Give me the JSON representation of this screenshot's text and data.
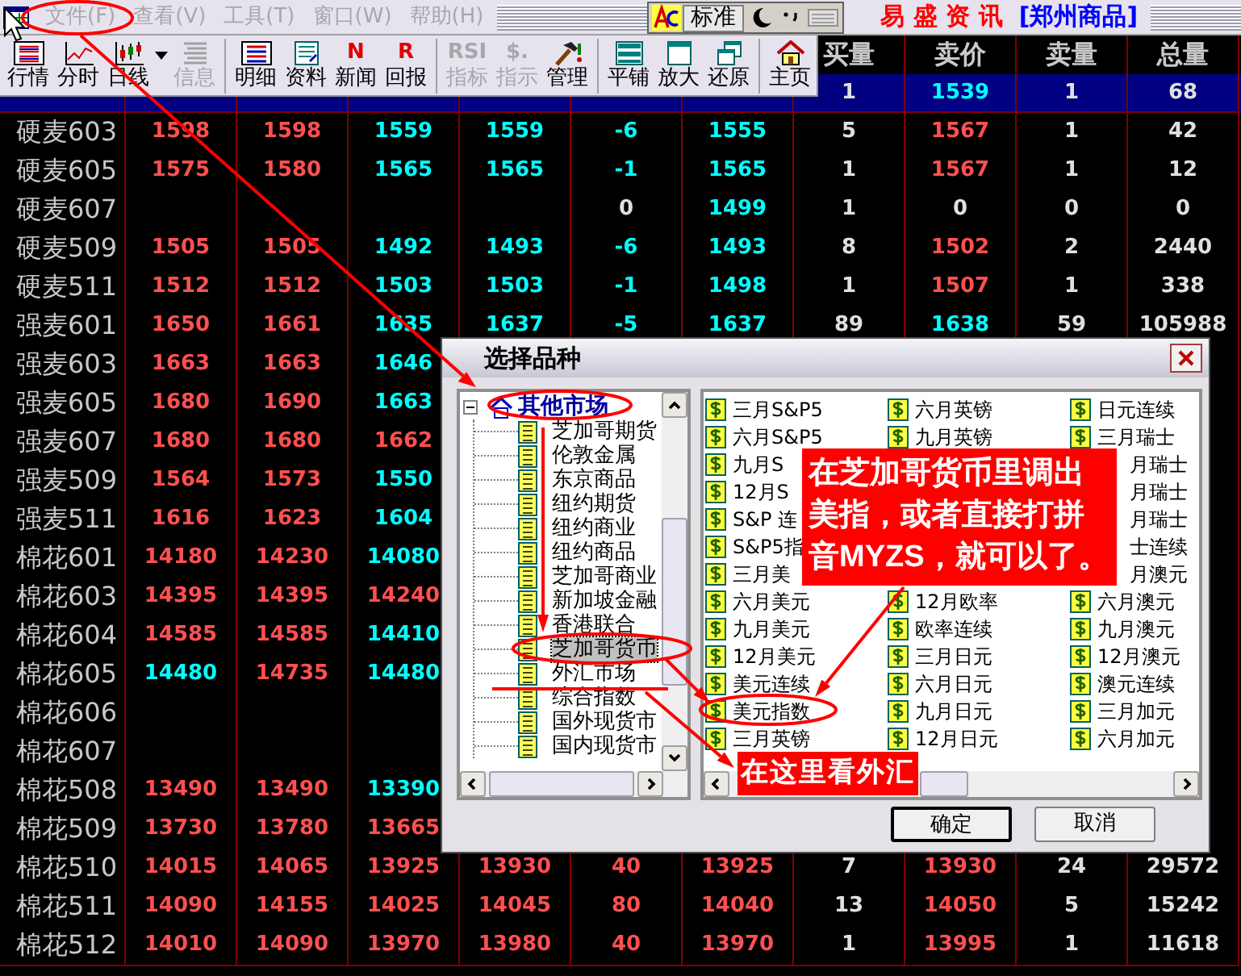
{
  "menu_bar": {
    "items": [
      {
        "label": "文件(F)",
        "disabled": true
      },
      {
        "label": "查看(V)",
        "disabled": true
      },
      {
        "label": "工具(T)",
        "disabled": true
      },
      {
        "label": "窗口(W)",
        "disabled": true
      },
      {
        "label": "帮助(H)",
        "disabled": true
      }
    ]
  },
  "ime_bar": {
    "mode": "标准"
  },
  "title": {
    "name": "易 盛 资 讯",
    "market": "[郑州商品]"
  },
  "toolbar": [
    [
      {
        "label": "行情",
        "kind": "quote",
        "disabled": false,
        "dropdown": false
      },
      {
        "label": "分时",
        "kind": "chart",
        "disabled": false,
        "dropdown": false
      },
      {
        "label": "日线",
        "kind": "candle",
        "disabled": false,
        "dropdown": true
      },
      {
        "label": "信息",
        "kind": "info",
        "disabled": true,
        "dropdown": false
      }
    ],
    [
      {
        "label": "明细",
        "kind": "detail",
        "disabled": false,
        "dropdown": false
      },
      {
        "label": "资料",
        "kind": "doc",
        "disabled": false,
        "dropdown": false
      },
      {
        "label": "新闻",
        "kind": "letter",
        "icon_text": "N",
        "disabled": false,
        "dropdown": false
      },
      {
        "label": "回报",
        "kind": "letter",
        "icon_text": "R",
        "disabled": false,
        "dropdown": false
      }
    ],
    [
      {
        "label": "指标",
        "kind": "letter",
        "icon_text": "RSI",
        "disabled": true,
        "dropdown": false
      },
      {
        "label": "指示",
        "kind": "letter",
        "icon_text": "$.",
        "disabled": true,
        "dropdown": false
      },
      {
        "label": "管理",
        "kind": "hammer",
        "disabled": false,
        "dropdown": false
      }
    ],
    [
      {
        "label": "平铺",
        "kind": "tile",
        "disabled": false,
        "dropdown": false
      },
      {
        "label": "放大",
        "kind": "window",
        "disabled": false,
        "dropdown": false
      },
      {
        "label": "还原",
        "kind": "restore",
        "disabled": false,
        "dropdown": false
      }
    ],
    [
      {
        "label": "主页",
        "kind": "home",
        "disabled": false,
        "dropdown": false
      }
    ]
  ],
  "quote_table": {
    "columns": [
      "",
      "",
      "",
      "",
      "",
      "",
      "买量",
      "卖价",
      "卖量",
      "总量"
    ],
    "rows": [
      {
        "name": null,
        "selected": true,
        "cells": [
          null,
          null,
          null,
          null,
          null,
          null,
          {
            "text": "1",
            "color": "#e0e0e0"
          },
          {
            "text": "1539",
            "color": "#00ffff"
          },
          {
            "text": "1",
            "color": "#e0e0e0"
          },
          {
            "text": "68",
            "color": "#e0e0e0"
          }
        ]
      },
      {
        "name": "硬麦603",
        "selected": false,
        "cells": [
          {
            "text": "1598",
            "color": "#ff5050"
          },
          {
            "text": "1598",
            "color": "#ff5050"
          },
          {
            "text": "1559",
            "color": "#00ffff"
          },
          {
            "text": "1559",
            "color": "#00ffff"
          },
          {
            "text": "-6",
            "color": "#00ffff"
          },
          {
            "text": "1555",
            "color": "#00ffff"
          },
          {
            "text": "5",
            "color": "#e0e0e0"
          },
          {
            "text": "1567",
            "color": "#ff5050"
          },
          {
            "text": "1",
            "color": "#e0e0e0"
          },
          {
            "text": "42",
            "color": "#e0e0e0"
          }
        ]
      },
      {
        "name": "硬麦605",
        "selected": false,
        "cells": [
          {
            "text": "1575",
            "color": "#ff5050"
          },
          {
            "text": "1580",
            "color": "#ff5050"
          },
          {
            "text": "1565",
            "color": "#00ffff"
          },
          {
            "text": "1565",
            "color": "#00ffff"
          },
          {
            "text": "-1",
            "color": "#00ffff"
          },
          {
            "text": "1565",
            "color": "#00ffff"
          },
          {
            "text": "1",
            "color": "#e0e0e0"
          },
          {
            "text": "1567",
            "color": "#ff5050"
          },
          {
            "text": "1",
            "color": "#e0e0e0"
          },
          {
            "text": "12",
            "color": "#e0e0e0"
          }
        ]
      },
      {
        "name": "硬麦607",
        "selected": false,
        "cells": [
          null,
          null,
          null,
          null,
          {
            "text": "0",
            "color": "#e0e0e0"
          },
          {
            "text": "1499",
            "color": "#00ffff"
          },
          {
            "text": "1",
            "color": "#e0e0e0"
          },
          {
            "text": "0",
            "color": "#e0e0e0"
          },
          {
            "text": "0",
            "color": "#e0e0e0"
          },
          {
            "text": "0",
            "color": "#e0e0e0"
          }
        ]
      },
      {
        "name": "硬麦509",
        "selected": false,
        "cells": [
          {
            "text": "1505",
            "color": "#ff5050"
          },
          {
            "text": "1505",
            "color": "#ff5050"
          },
          {
            "text": "1492",
            "color": "#00ffff"
          },
          {
            "text": "1493",
            "color": "#00ffff"
          },
          {
            "text": "-6",
            "color": "#00ffff"
          },
          {
            "text": "1493",
            "color": "#00ffff"
          },
          {
            "text": "8",
            "color": "#e0e0e0"
          },
          {
            "text": "1502",
            "color": "#ff5050"
          },
          {
            "text": "2",
            "color": "#e0e0e0"
          },
          {
            "text": "2440",
            "color": "#e0e0e0"
          }
        ]
      },
      {
        "name": "硬麦511",
        "selected": false,
        "cells": [
          {
            "text": "1512",
            "color": "#ff5050"
          },
          {
            "text": "1512",
            "color": "#ff5050"
          },
          {
            "text": "1503",
            "color": "#00ffff"
          },
          {
            "text": "1503",
            "color": "#00ffff"
          },
          {
            "text": "-1",
            "color": "#00ffff"
          },
          {
            "text": "1498",
            "color": "#00ffff"
          },
          {
            "text": "1",
            "color": "#e0e0e0"
          },
          {
            "text": "1507",
            "color": "#ff5050"
          },
          {
            "text": "1",
            "color": "#e0e0e0"
          },
          {
            "text": "338",
            "color": "#e0e0e0"
          }
        ]
      },
      {
        "name": "强麦601",
        "selected": false,
        "cells": [
          {
            "text": "1650",
            "color": "#ff5050"
          },
          {
            "text": "1661",
            "color": "#ff5050"
          },
          {
            "text": "1635",
            "color": "#00ffff"
          },
          {
            "text": "1637",
            "color": "#00ffff"
          },
          {
            "text": "-5",
            "color": "#00ffff"
          },
          {
            "text": "1637",
            "color": "#00ffff"
          },
          {
            "text": "89",
            "color": "#e0e0e0"
          },
          {
            "text": "1638",
            "color": "#00ffff"
          },
          {
            "text": "59",
            "color": "#e0e0e0"
          },
          {
            "text": "105988",
            "color": "#e0e0e0"
          }
        ]
      },
      {
        "name": "强麦603",
        "selected": false,
        "cells": [
          {
            "text": "1663",
            "color": "#ff5050"
          },
          {
            "text": "1663",
            "color": "#ff5050"
          },
          {
            "text": "1646",
            "color": "#00ffff"
          },
          null,
          null,
          null,
          null,
          null,
          null,
          null
        ]
      },
      {
        "name": "强麦605",
        "selected": false,
        "cells": [
          {
            "text": "1680",
            "color": "#ff5050"
          },
          {
            "text": "1690",
            "color": "#ff5050"
          },
          {
            "text": "1663",
            "color": "#00ffff"
          },
          null,
          null,
          null,
          null,
          null,
          null,
          null
        ]
      },
      {
        "name": "强麦607",
        "selected": false,
        "cells": [
          {
            "text": "1680",
            "color": "#ff5050"
          },
          {
            "text": "1680",
            "color": "#ff5050"
          },
          {
            "text": "1662",
            "color": "#ff5050"
          },
          null,
          null,
          null,
          null,
          null,
          null,
          null
        ]
      },
      {
        "name": "强麦509",
        "selected": false,
        "cells": [
          {
            "text": "1564",
            "color": "#ff5050"
          },
          {
            "text": "1573",
            "color": "#ff5050"
          },
          {
            "text": "1550",
            "color": "#00ffff"
          },
          null,
          null,
          null,
          null,
          null,
          null,
          null
        ]
      },
      {
        "name": "强麦511",
        "selected": false,
        "cells": [
          {
            "text": "1616",
            "color": "#ff5050"
          },
          {
            "text": "1623",
            "color": "#ff5050"
          },
          {
            "text": "1604",
            "color": "#00ffff"
          },
          null,
          null,
          null,
          null,
          null,
          null,
          null
        ]
      },
      {
        "name": "棉花601",
        "selected": false,
        "cells": [
          {
            "text": "14180",
            "color": "#ff5050"
          },
          {
            "text": "14230",
            "color": "#ff5050"
          },
          {
            "text": "14080",
            "color": "#00ffff"
          },
          null,
          null,
          null,
          null,
          null,
          null,
          null
        ]
      },
      {
        "name": "棉花603",
        "selected": false,
        "cells": [
          {
            "text": "14395",
            "color": "#ff5050"
          },
          {
            "text": "14395",
            "color": "#ff5050"
          },
          {
            "text": "14240",
            "color": "#ff5050"
          },
          null,
          null,
          null,
          null,
          null,
          null,
          null
        ]
      },
      {
        "name": "棉花604",
        "selected": false,
        "cells": [
          {
            "text": "14585",
            "color": "#ff5050"
          },
          {
            "text": "14585",
            "color": "#ff5050"
          },
          {
            "text": "14410",
            "color": "#00ffff"
          },
          null,
          null,
          null,
          null,
          null,
          null,
          null
        ]
      },
      {
        "name": "棉花605",
        "selected": false,
        "cells": [
          {
            "text": "14480",
            "color": "#00ffff"
          },
          {
            "text": "14735",
            "color": "#ff5050"
          },
          {
            "text": "14480",
            "color": "#00ffff"
          },
          null,
          null,
          null,
          null,
          null,
          null,
          null
        ]
      },
      {
        "name": "棉花606",
        "selected": false,
        "cells": [
          null,
          null,
          null,
          null,
          null,
          null,
          null,
          null,
          null,
          null
        ]
      },
      {
        "name": "棉花607",
        "selected": false,
        "cells": [
          null,
          null,
          null,
          null,
          null,
          null,
          null,
          null,
          null,
          null
        ]
      },
      {
        "name": "棉花508",
        "selected": false,
        "cells": [
          {
            "text": "13490",
            "color": "#ff5050"
          },
          {
            "text": "13490",
            "color": "#ff5050"
          },
          {
            "text": "13390",
            "color": "#00ffff"
          },
          null,
          null,
          null,
          null,
          null,
          null,
          null
        ]
      },
      {
        "name": "棉花509",
        "selected": false,
        "cells": [
          {
            "text": "13730",
            "color": "#ff5050"
          },
          {
            "text": "13780",
            "color": "#ff5050"
          },
          {
            "text": "13665",
            "color": "#ff5050"
          },
          null,
          null,
          null,
          null,
          null,
          null,
          null
        ]
      },
      {
        "name": "棉花510",
        "selected": false,
        "cells": [
          {
            "text": "14015",
            "color": "#ff5050"
          },
          {
            "text": "14065",
            "color": "#ff5050"
          },
          {
            "text": "13925",
            "color": "#ff5050"
          },
          {
            "text": "13930",
            "color": "#ff5050"
          },
          {
            "text": "40",
            "color": "#ff5050"
          },
          {
            "text": "13925",
            "color": "#ff5050"
          },
          {
            "text": "7",
            "color": "#e0e0e0"
          },
          {
            "text": "13930",
            "color": "#ff5050"
          },
          {
            "text": "24",
            "color": "#e0e0e0"
          },
          {
            "text": "29572",
            "color": "#e0e0e0"
          }
        ]
      },
      {
        "name": "棉花511",
        "selected": false,
        "cells": [
          {
            "text": "14090",
            "color": "#ff5050"
          },
          {
            "text": "14155",
            "color": "#ff5050"
          },
          {
            "text": "14025",
            "color": "#ff5050"
          },
          {
            "text": "14045",
            "color": "#ff5050"
          },
          {
            "text": "80",
            "color": "#ff5050"
          },
          {
            "text": "14040",
            "color": "#ff5050"
          },
          {
            "text": "13",
            "color": "#e0e0e0"
          },
          {
            "text": "14050",
            "color": "#ff5050"
          },
          {
            "text": "5",
            "color": "#e0e0e0"
          },
          {
            "text": "15242",
            "color": "#e0e0e0"
          }
        ]
      },
      {
        "name": "棉花512",
        "selected": false,
        "cells": [
          {
            "text": "14010",
            "color": "#ff5050"
          },
          {
            "text": "14090",
            "color": "#ff5050"
          },
          {
            "text": "13970",
            "color": "#ff5050"
          },
          {
            "text": "13980",
            "color": "#ff5050"
          },
          {
            "text": "40",
            "color": "#ff5050"
          },
          {
            "text": "13970",
            "color": "#ff5050"
          },
          {
            "text": "1",
            "color": "#e0e0e0"
          },
          {
            "text": "13995",
            "color": "#ff5050"
          },
          {
            "text": "1",
            "color": "#e0e0e0"
          },
          {
            "text": "11618",
            "color": "#e0e0e0"
          }
        ]
      }
    ]
  },
  "dialog": {
    "title": "选择品种",
    "tree": {
      "label": "其他市场",
      "expanded": true,
      "children": [
        {
          "label": "芝加哥期货",
          "selected": false
        },
        {
          "label": "伦敦金属",
          "selected": false
        },
        {
          "label": "东京商品",
          "selected": false
        },
        {
          "label": "纽约期货",
          "selected": false
        },
        {
          "label": "纽约商业",
          "selected": false
        },
        {
          "label": "纽约商品",
          "selected": false
        },
        {
          "label": "芝加哥商业",
          "selected": false
        },
        {
          "label": "新加坡金融",
          "selected": false
        },
        {
          "label": "香港联合",
          "selected": false
        },
        {
          "label": "芝加哥货币",
          "selected": true
        },
        {
          "label": "外汇市场",
          "selected": false
        },
        {
          "label": "综合指数",
          "selected": false
        },
        {
          "label": "国外现货市",
          "selected": false
        },
        {
          "label": "国内现货市",
          "selected": false
        }
      ]
    },
    "list_columns": [
      {
        "items": [
          {
            "label": "三月S&P5",
            "kind": "whole"
          },
          {
            "label": "六月S&P5",
            "kind": "whole"
          },
          {
            "label": "九月S",
            "kind": "whole"
          },
          {
            "label": "12月S",
            "kind": "whole"
          },
          {
            "label": "S&P 连",
            "kind": "whole"
          },
          {
            "label": "S&P5指",
            "kind": "whole"
          },
          {
            "label": "三月美",
            "kind": "whole"
          },
          {
            "label": "六月美元",
            "kind": "whole"
          },
          {
            "label": "九月美元",
            "kind": "whole"
          },
          {
            "label": "12月美元",
            "kind": "whole"
          },
          {
            "label": "美元连续",
            "kind": "whole"
          },
          {
            "label": "美元指数",
            "kind": "whole"
          },
          {
            "label": "三月英镑",
            "kind": "whole"
          }
        ]
      },
      {
        "items": [
          {
            "label": "六月英镑",
            "kind": "whole"
          },
          {
            "label": "九月英镑",
            "kind": "whole"
          }
        ],
        "items_below_callout": [
          {
            "label": "12月欧率",
            "kind": "whole"
          },
          {
            "label": "欧率连续",
            "kind": "whole"
          },
          {
            "label": "三月日元",
            "kind": "whole"
          },
          {
            "label": "六月日元",
            "kind": "whole"
          },
          {
            "label": "九月日元",
            "kind": "whole"
          },
          {
            "label": "12月日元",
            "kind": "whole"
          }
        ]
      },
      {
        "items": [
          {
            "label": "日元连续",
            "kind": "whole"
          },
          {
            "label": "三月瑞士",
            "kind": "whole"
          },
          {
            "label": "月瑞士",
            "kind": "tail"
          },
          {
            "label": "月瑞士",
            "kind": "tail"
          },
          {
            "label": "月瑞士",
            "kind": "tail"
          },
          {
            "label": "士连续",
            "kind": "tail"
          },
          {
            "label": "月澳元",
            "kind": "tail"
          },
          {
            "label": "六月澳元",
            "kind": "whole"
          },
          {
            "label": "九月澳元",
            "kind": "whole"
          },
          {
            "label": "12月澳元",
            "kind": "whole"
          },
          {
            "label": "澳元连续",
            "kind": "whole"
          },
          {
            "label": "三月加元",
            "kind": "whole"
          },
          {
            "label": "六月加元",
            "kind": "whole"
          }
        ]
      }
    ],
    "buttons": [
      {
        "label": "确定",
        "default": true
      },
      {
        "label": "取消",
        "default": false
      }
    ]
  },
  "callouts": [
    "在芝加哥货币里调出美指，或者直接打拼音MYZS，就可以了。",
    "在这里看外汇"
  ]
}
